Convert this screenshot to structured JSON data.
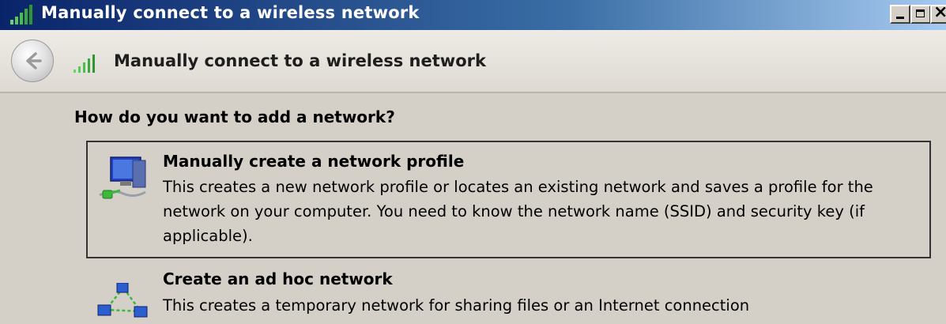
{
  "window": {
    "title": "Manually connect to a wireless network",
    "controls": {
      "minimize": "minimize",
      "maximize": "maximize",
      "close": "×"
    }
  },
  "header": {
    "title": "Manually connect to a wireless network",
    "back_icon": "back-arrow-icon",
    "wireless_icon": "wireless-signal-icon"
  },
  "question": "How do you want to add a network?",
  "options": [
    {
      "title": "Manually create a network profile",
      "description": "This creates a new network profile or locates an existing network and saves a profile for the network on your computer. You need to know the network name (SSID) and security key (if applicable).",
      "icon": "network-computer-icon"
    },
    {
      "title": "Create an ad hoc network",
      "description": "This creates a temporary network for sharing files or an Internet connection",
      "icon": "ad-hoc-network-icon"
    }
  ],
  "colors": {
    "title_bar_start": "#0a246a",
    "title_bar_end": "#a6caf0",
    "window_bg": "#d4d0c8"
  }
}
